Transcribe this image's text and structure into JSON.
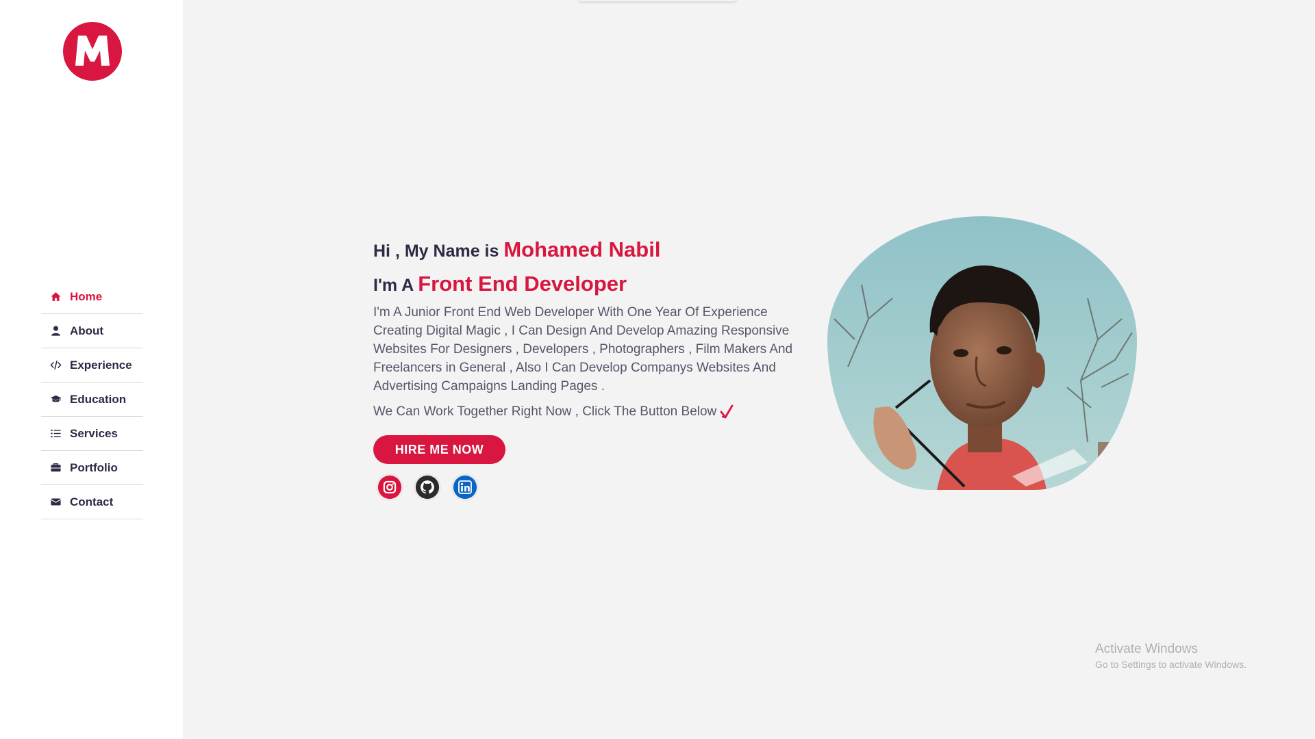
{
  "sidebar": {
    "logo_letter": "M",
    "items": [
      {
        "label": "Home",
        "icon": "home-icon",
        "active": true
      },
      {
        "label": "About",
        "icon": "user-icon",
        "active": false
      },
      {
        "label": "Experience",
        "icon": "code-icon",
        "active": false
      },
      {
        "label": "Education",
        "icon": "graduation-cap-icon",
        "active": false
      },
      {
        "label": "Services",
        "icon": "list-icon",
        "active": false
      },
      {
        "label": "Portfolio",
        "icon": "briefcase-icon",
        "active": false
      },
      {
        "label": "Contact",
        "icon": "envelope-icon",
        "active": false
      }
    ]
  },
  "hero": {
    "greeting_prefix": "Hi , My Name is",
    "name": "Mohamed Nabil",
    "role_prefix": "I'm A",
    "role": "Front End Developer",
    "bio": "I'm A Junior Front End Web Developer With One Year Of Experience Creating Digital Magic , I Can Design And Develop Amazing Responsive Websites For Designers , Developers , Photographers , Film Makers And Freelancers in General , Also I Can Develop Companys Websites And Advertising Campaigns Landing Pages .",
    "cta_text": "We Can Work Together Right Now , Click The Button Below",
    "hire_label": "HIRE ME NOW",
    "socials": [
      {
        "icon": "instagram-icon",
        "color": "#d8163f"
      },
      {
        "icon": "github-icon",
        "color": "#2b2b2b"
      },
      {
        "icon": "linkedin-icon",
        "color": "#0a66c2"
      }
    ]
  },
  "colors": {
    "accent": "#d8163f",
    "text_dark": "#2b2b45",
    "background": "#f4f3f3"
  },
  "watermark": {
    "title": "Activate Windows",
    "subtitle": "Go to Settings to activate Windows."
  }
}
